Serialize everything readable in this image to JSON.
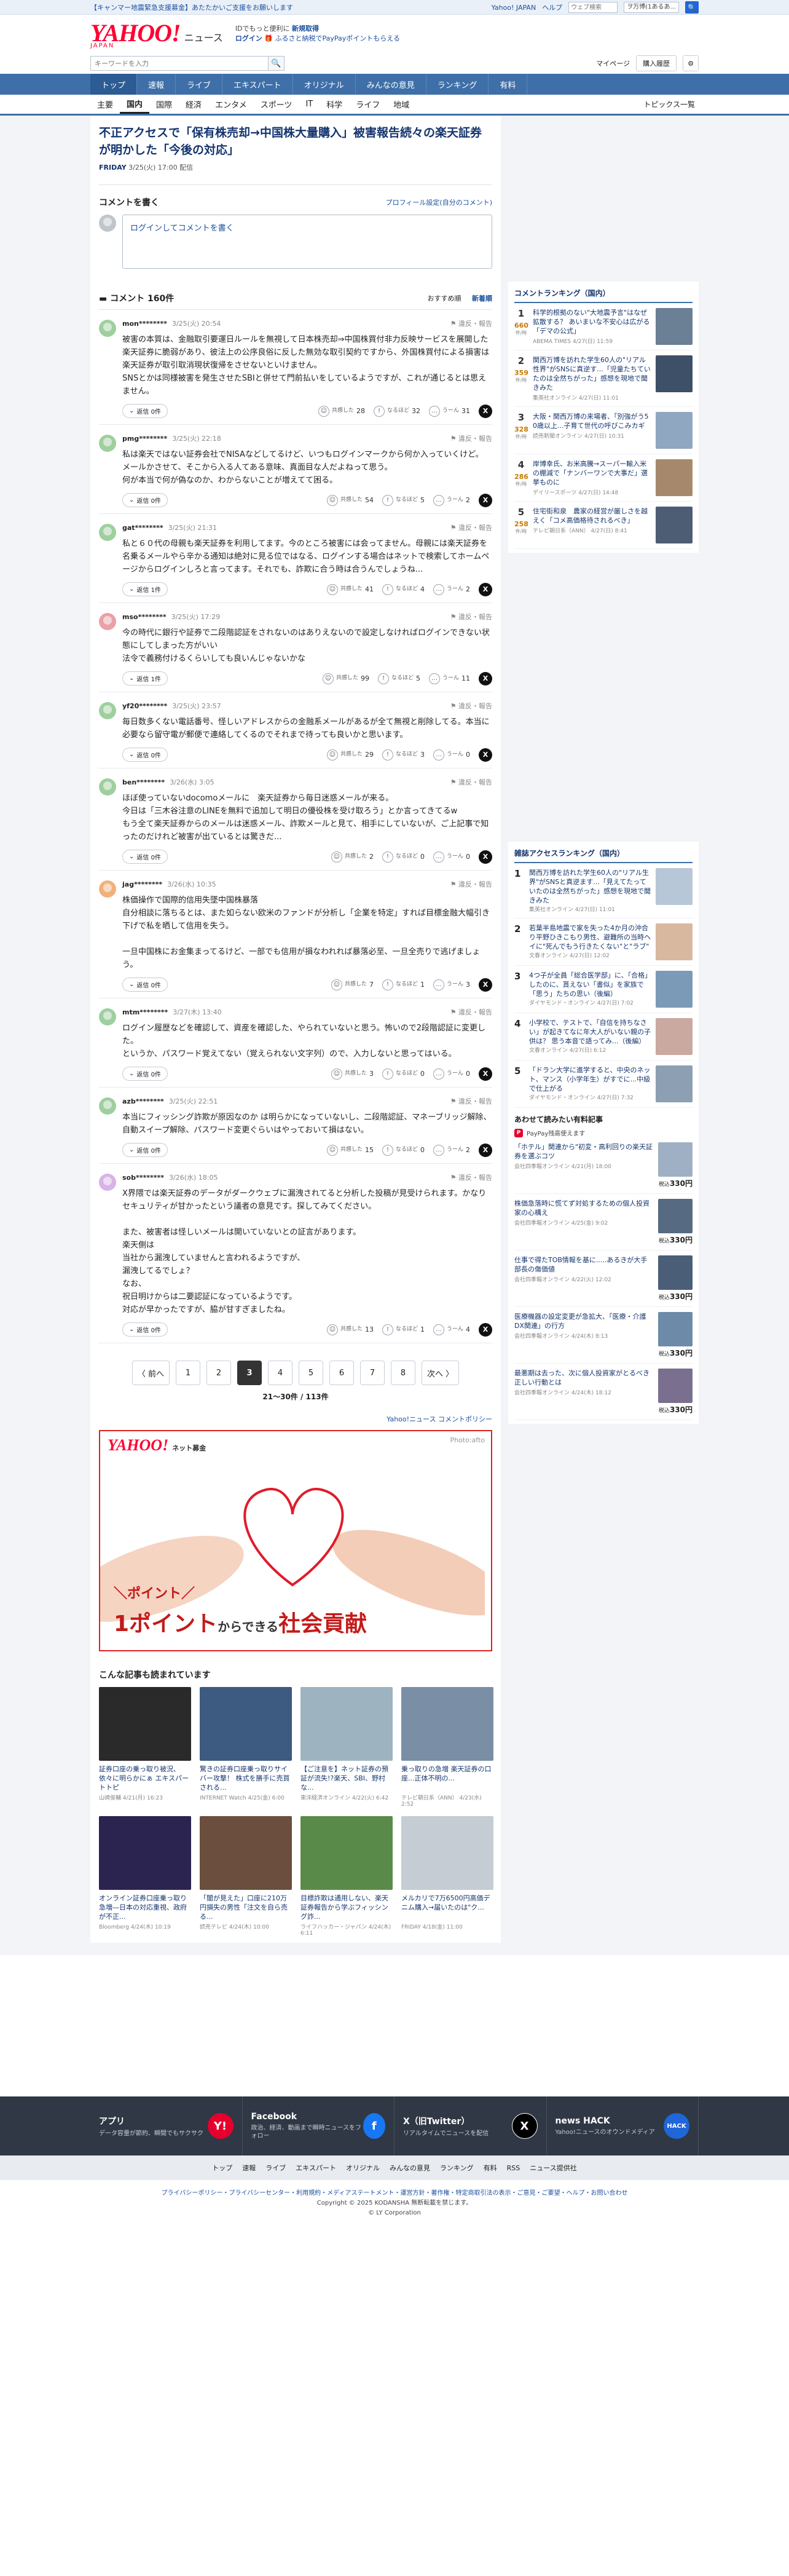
{
  "topbar": {
    "promo": "【キャンマー地震緊急支援募金】あたたかいご支援をお願いします",
    "yahoo_japan": "Yahoo! JAPAN",
    "help": "ヘルプ",
    "search_placeholder": "ウェブ検索",
    "select": "ヲ万博(1あるあ...",
    "search_go": "🔍"
  },
  "header": {
    "logo": "YAHOO!",
    "logo_sub": "JAPAN",
    "title": "ニュース",
    "msg_line1": "IDでもっと便利に",
    "msg_link1": "新規取得",
    "msg_login": "ログイン",
    "msg_line2": "ふるさと納税でPayPayポイントもらえる"
  },
  "searchrow": {
    "placeholder": "キーワードを入力",
    "mypage": "マイページ",
    "buy_history": "購入履歴"
  },
  "mainnav": [
    "トップ",
    "速報",
    "ライブ",
    "エキスパート",
    "オリジナル",
    "みんなの意見",
    "ランキング",
    "有料"
  ],
  "subnav": [
    "主要",
    "国内",
    "国際",
    "経済",
    "エンタメ",
    "スポーツ",
    "IT",
    "科学",
    "ライフ",
    "地域"
  ],
  "subnav_topics": "トピックス一覧",
  "article": {
    "title": "不正アクセスで「保有株売却→中国株大量購入」被害報告続々の楽天証券が明かした「今後の対応」",
    "source": "FRIDAY",
    "date": "3/25(火) 17:00 配信"
  },
  "comment_write": {
    "heading": "コメントを書く",
    "profile_link": "プロフィール設定(自分のコメント)",
    "login_text": "ログインしてコメントを書く"
  },
  "comment_list": {
    "count_label": "コメント 160件",
    "sort_recommend": "おすすめ順",
    "sort_new": "新着順"
  },
  "labels": {
    "report": "違反・報告",
    "reply": "返信",
    "react_a": "共感した",
    "react_b": "なるほど",
    "react_c": "うーん",
    "x": "X"
  },
  "comments": [
    {
      "user": "mon********",
      "date": "3/25(火) 20:54",
      "text": "被害の本質は、金融取引要運日ルールを無視して日本株売却⇒中国株買付非力反映サービスを展開した楽天証券に脆弱があり、彼法上の公序良俗に反した無効な取引契約ですから、外国株買付による損害は楽天証券が取引取消現状復帰をさせないといけません。\nSNSとかは同様被害を発生させたSBIと併せて門前払いをしているようですが、これが通じるとは思えません。",
      "reply": "返信 0件",
      "a": "28",
      "b": "32",
      "c": "31",
      "color": "#9fcf9f"
    },
    {
      "user": "pmg********",
      "date": "3/25(火) 22:18",
      "text": "私は楽天ではない証券会社でNISAなどしてるけど、いつもログインマークから何か入っていくけど。\nメールかさせて、そこから入る人てある意味、真面目な人だよねって思う。\n何が本当で何が偽なのか、わからないことが増えてて困る。",
      "reply": "返信 0件",
      "a": "54",
      "b": "5",
      "c": "2",
      "color": "#9fcf9f"
    },
    {
      "user": "gat********",
      "date": "3/25(火) 21:31",
      "text": "私と６０代の母親も楽天証券を利用してます。今のところ被害には会ってません。母親には楽天証券を名乗るメールやら辛かる通知は絶対に見る位ではなる、ログインする場合はネットで検索してホームページからログインしろと言ってます。それでも、詐欺に合う時は合うんでしょうね...",
      "reply": "返信 1件",
      "a": "41",
      "b": "4",
      "c": "2",
      "color": "#9fcf9f"
    },
    {
      "user": "mso********",
      "date": "3/25(火) 17:29",
      "text": "今の時代に銀行や証券で二段階認証をされないのはありえないので設定しなければログインできない状態にしてしまった方がいい\n法令で義務付けるくらいしても良いんじゃないかな",
      "reply": "返信 1件",
      "a": "99",
      "b": "5",
      "c": "11",
      "color": "#e9a0a6"
    },
    {
      "user": "yf20********",
      "date": "3/25(火) 23:57",
      "text": "毎日数多くない電話番号、怪しいアドレスからの金融系メールがあるが全て無視と削除してる。本当に必要なら留守電が郵便で連絡してくるのでそれまで待っても良いかと思います。",
      "reply": "返信 0件",
      "a": "29",
      "b": "3",
      "c": "0",
      "color": "#9fcf9f"
    },
    {
      "user": "ben********",
      "date": "3/26(水) 3:05",
      "text": "ほぼ使っていないdocomoメールに　楽天証券から毎日迷惑メールが来る。\n今日は「三木谷注意のLINEを無料で追加して明日の優役株を受け取ろう」とか言ってきてるw\nもう全て楽天証券からのメールは迷惑メール、詐欺メールと見て、相手にしていないが、ご上記事で知ったのだけれど被害が出ているとは驚きだ...",
      "reply": "返信 0件",
      "a": "2",
      "b": "0",
      "c": "0",
      "color": "#9fcf9f"
    },
    {
      "user": "jag********",
      "date": "3/26(水) 10:35",
      "text": "株価操作で国際的信用失墜中国株暴落\n自分相談に落ちるとは、また如らない欧米のファンドが分析し「企業を特定」すれば目標金融大幅引き下げで私を晒して信用を失う。\n\n一旦中国株にお金集まってるけど、一部でも信用が損なわれれば暴落必至、一旦全売りで逃げましょう。",
      "reply": "返信 0件",
      "a": "7",
      "b": "1",
      "c": "3",
      "color": "#f0b27a"
    },
    {
      "user": "mtm********",
      "date": "3/27(木) 13:40",
      "text": "ログイン履歴などを確認して、資産を確認した、やられていないと思う。怖いので2段階認証に変更した。\nというか、パスワード覚えてない（覚えられない文字列）ので、入力しないと思ってはいる。",
      "reply": "返信 0件",
      "a": "3",
      "b": "0",
      "c": "0",
      "color": "#9fcf9f"
    },
    {
      "user": "azb********",
      "date": "3/25(火) 22:51",
      "text": "本当にフィッシング詐欺が原因なのか は明らかになっていないし、二段階認証、マネーブリッジ解除、自動スイープ解除、パスワード変更ぐらいはやっておいて損はない。",
      "reply": "返信 0件",
      "a": "15",
      "b": "0",
      "c": "2",
      "color": "#9fcf9f"
    },
    {
      "user": "sob********",
      "date": "3/26(水) 18:05",
      "text": "X界隈では楽天証券のデータがダークウェブに漏洩されてると分析した投稿が見受けられます。かなりセキュリティが甘かったという議者の意見です。探してみてください。\n\nまた、被害者は怪しいメールは開いていないとの証言があります。\n楽天側は\n当社から漏洩していませんと言われるようですが、\n漏洩してるでしょ？\nなお、\n祝日明けからは二要認証になっているようです。\n対応が早かったですが、脇が甘すぎましたね。",
      "reply": "返信 0件",
      "a": "13",
      "b": "1",
      "c": "4",
      "color": "#d7b3e8"
    }
  ],
  "pager": {
    "prev": "〈 前へ",
    "pages": [
      "1",
      "2",
      "3",
      "4",
      "5",
      "6",
      "7",
      "8"
    ],
    "current": "3",
    "next": "次へ 〉",
    "info": "21～30件 / 113件"
  },
  "policy": "Yahoo!ニュース コメントポリシー",
  "ad": {
    "logo": "YAHOO!",
    "logo_sub": "ネット募金",
    "photo": "Photo:afto",
    "line1": "＼ポイント／",
    "line2_a": "1ポイント",
    "line2_b": "からできる",
    "line2_c": "社会貢献"
  },
  "related_title": "こんな記事も読まれています",
  "related": [
    {
      "title": "証券口座の乗っ取り被況、依々に明らかにぁ エキスパートトピ",
      "src": "山崎俊輔",
      "date": "4/21(月) 16:23"
    },
    {
      "title": "驚きの証券口座乗っ取りサイバー攻撃！ 株式を勝手に売買される...",
      "src": "INTERNET Watch",
      "date": "4/25(金) 6:00"
    },
    {
      "title": "【ご注意を】ネット証券の預証が流失!?楽天、SBI、野村な...",
      "src": "東洋経済オンライン",
      "date": "4/22(火) 6:42"
    },
    {
      "title": "乗っ取りの急増 楽天証券の口座...正体不明の...",
      "src": "テレビ朝日系（ANN）",
      "date": "4/23(水) 2:52"
    },
    {
      "title": "オンライン証券口座乗っ取り急増―日本の対応重視、政府が不正...",
      "src": "Bloomberg",
      "date": "4/24(木) 10:19"
    },
    {
      "title": "「闇が見えた」口座に210万円損失の男性「注文を自ら売る...",
      "src": "読売テレビ",
      "date": "4/24(木) 10:00"
    },
    {
      "title": "目標詐欺は通用しない、楽天証券報告から学ぶフィッシング詐...",
      "src": "ライフハッカー・ジャパン",
      "date": "4/24(木) 6:11"
    },
    {
      "title": "メルカリで7万6500円高価デニム購入→届いたのは\"ク...",
      "src": "FRIDAY",
      "date": "4/18(金) 11:00"
    }
  ],
  "side_rank": {
    "title": "コメントランキング（国内）",
    "unit": "件/時",
    "items": [
      {
        "n": "1",
        "count": "660",
        "title": "科学的根拠のない\"大地震予言\"はなぜ拡散する？ あいまいな不安心は広がる「デマの公式」",
        "src": "ABEMA TIMES 4/27(日) 11:59"
      },
      {
        "n": "2",
        "count": "359",
        "title": "関西万博を訪れた学生60人の\"リアル性界\"がSNSに真逆す...「児童たちていたのは全然ちがった」感想を現地で聞きみた",
        "src": "集英社オンライン 4/27(日) 11:01"
      },
      {
        "n": "3",
        "count": "328",
        "title": "大阪・関西万博の来場者、「別強がう5 0歳以上...子育て世代の呼びこみカギ",
        "src": "読売新聞オンライン 4/27(日) 10:31"
      },
      {
        "n": "4",
        "count": "286",
        "title": "岸博幸氏、お米高騰→スーパー輸入米の棚減で「ナンバーワンで大事だ」選挙ものに",
        "src": "デイリースポーツ 4/27(日) 14:48"
      },
      {
        "n": "5",
        "count": "258",
        "title": "住宅街和泉　農家の経営が厳しさを越えく「コメ高価格待されるべき」",
        "src": "テレビ朝日系（ANN） 4/27(日) 8:41"
      }
    ]
  },
  "side_access": {
    "title": "雑誌アクセスランキング（国内）",
    "items": [
      {
        "n": "1",
        "title": "関西万博を訪れた学生60人の\"リアル生界\"がSNSと真逆ます...「見えてたっていたのは全然ちがった」感想を現地で聞きみた",
        "src": "集英社オンライン 4/27(日) 11:01"
      },
      {
        "n": "2",
        "title": "若葉半島地震で家を失った4か月の沖合り平野ひきこもり男性、避難所の当時ヘイに\"死んでもう行きたくない\"と\"ラブ\"",
        "src": "文春オンライン 4/27(日) 12:02"
      },
      {
        "n": "3",
        "title": "4つ子が全員「総合医学部」に、「合格」したのに、貰えない「書似」を家族で「思う」たちの思い（後編）",
        "src": "ダイヤモンド・オンライン 4/27(日) 7:02"
      },
      {
        "n": "4",
        "title": "小学校で、テストで、「自信を持ちなさい」が起きてなに年大人がいない親の子供は？ 思う本音で語ってみ...（後編）",
        "src": "文春オンライン 4/27(日) 6:12"
      },
      {
        "n": "5",
        "title": "「ドラン大学に進学すると、中央のネット、マンス（小学年生）がすでに...中級で仕上がる",
        "src": "ダイヤモンド・オンライン 4/27(日) 7:32"
      }
    ]
  },
  "side_paid": {
    "title": "あわせて読みたい有料記事",
    "badge": "PayPay残高使えます",
    "unit": "税込",
    "items": [
      {
        "title": "「ホテル」関連から\"初変・高利回りの楽天証券を選ぶコツ",
        "src": "会社四季報オンライン 4/21(月) 18:00",
        "price": "330円"
      },
      {
        "title": "株価急落時に慌てず対処するための個人投資家の心構え",
        "src": "会社四季報オンライン 4/25(金) 9:02",
        "price": "330円"
      },
      {
        "title": "仕事で得たTOB情報を基に.....あるきが大手 部長の傷価値",
        "src": "会社四季報オンライン 4/22(火) 12:02",
        "price": "330円"
      },
      {
        "title": "医療機器の設定変更が急拡大、「医療・介護DX関連」の行方",
        "src": "会社四季報オンライン 4/24(木) 8:13",
        "price": "330円"
      },
      {
        "title": "最悪期は去った、次に個人投資家がとるべき正しい行動とは",
        "src": "会社四季報オンライン 4/24(木) 18:12",
        "price": "330円"
      }
    ]
  },
  "footer": {
    "cells": [
      {
        "name": "アプリ",
        "desc": "データ容量が節約、瞬間でもサクサク",
        "icon": "Y!"
      },
      {
        "name": "Facebook",
        "desc": "政治、経済、動画まで瞬時ニュースをフォロー",
        "icon": "f"
      },
      {
        "name": "X（旧Twitter）",
        "desc": "リアルタイムでニュースを配信",
        "icon": "X"
      },
      {
        "name": "news HACK",
        "desc": "Yahoo!ニュースのオウンドメディア",
        "icon": "HACK"
      }
    ],
    "nav": [
      "トップ",
      "速報",
      "ライブ",
      "エキスパート",
      "オリジナル",
      "みんなの意見",
      "ランキング",
      "有料",
      "RSS",
      "ニュース提供社"
    ],
    "links": "プライバシーポリシー・プライバシーセンター・利用規約・メディアステートメント・運営方針・著作権・特定商取引法の表示・ご意見・ご要望・ヘルプ・お問い合わせ",
    "copyright1": "Copyright © 2025 KODANSHA 無断転載を禁じます。",
    "copyright2": "© LY Corporation"
  }
}
